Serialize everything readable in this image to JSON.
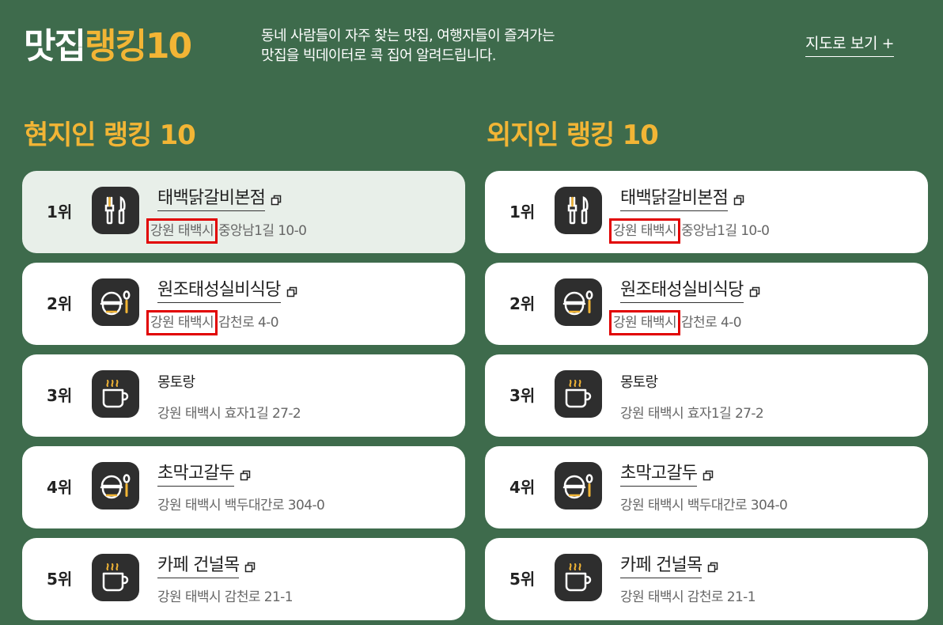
{
  "header": {
    "title_main": "맛집",
    "title_accent": "랭킹10",
    "desc_line1": "동네 사람들이 자주 찾는 맛집, 여행자들이 즐겨가는",
    "desc_line2": "맛집을 빅데이터로 콕 집어 알려드립니다.",
    "map_link": "지도로 보기 +"
  },
  "local": {
    "title": "현지인 랭킹 10",
    "items": [
      {
        "rank": "1위",
        "icon": "fork-knife-icon",
        "name": "태백닭갈비본점",
        "addr_hl": "강원 태백시",
        "addr_rest": "중앙남1길 10-0"
      },
      {
        "rank": "2위",
        "icon": "bowl-spoon-icon",
        "name": "원조태성실비식당",
        "addr_hl": "강원 태백시",
        "addr_rest": "감천로 4-0"
      },
      {
        "rank": "3위",
        "icon": "coffee-cup-icon",
        "name": "몽토랑",
        "addr_hl": "",
        "addr_rest": "강원 태백시 효자1길 27-2"
      },
      {
        "rank": "4위",
        "icon": "bowl-spoon-icon",
        "name": "초막고갈두",
        "addr_hl": "",
        "addr_rest": "강원 태백시 백두대간로 304-0"
      },
      {
        "rank": "5위",
        "icon": "coffee-cup-icon",
        "name": "카페 건널목",
        "addr_hl": "",
        "addr_rest": "강원 태백시 감천로 21-1"
      }
    ]
  },
  "visitor": {
    "title": "외지인 랭킹 10",
    "items": [
      {
        "rank": "1위",
        "icon": "fork-knife-icon",
        "name": "태백닭갈비본점",
        "addr_hl": "강원 태백시",
        "addr_rest": "중앙남1길 10-0"
      },
      {
        "rank": "2위",
        "icon": "bowl-spoon-icon",
        "name": "원조태성실비식당",
        "addr_hl": "강원 태백시",
        "addr_rest": "감천로 4-0"
      },
      {
        "rank": "3위",
        "icon": "coffee-cup-icon",
        "name": "몽토랑",
        "addr_hl": "",
        "addr_rest": "강원 태백시 효자1길 27-2"
      },
      {
        "rank": "4위",
        "icon": "bowl-spoon-icon",
        "name": "초막고갈두",
        "addr_hl": "",
        "addr_rest": "강원 태백시 백두대간로 304-0"
      },
      {
        "rank": "5위",
        "icon": "coffee-cup-icon",
        "name": "카페 건널목",
        "addr_hl": "",
        "addr_rest": "강원 태백시 감천로 21-1"
      }
    ]
  },
  "colors": {
    "background": "#3e6b4c",
    "accent": "#f2b535",
    "highlight_box": "#e10000",
    "active_card": "#e8efe9",
    "icon_bg": "#2e2e2e"
  }
}
